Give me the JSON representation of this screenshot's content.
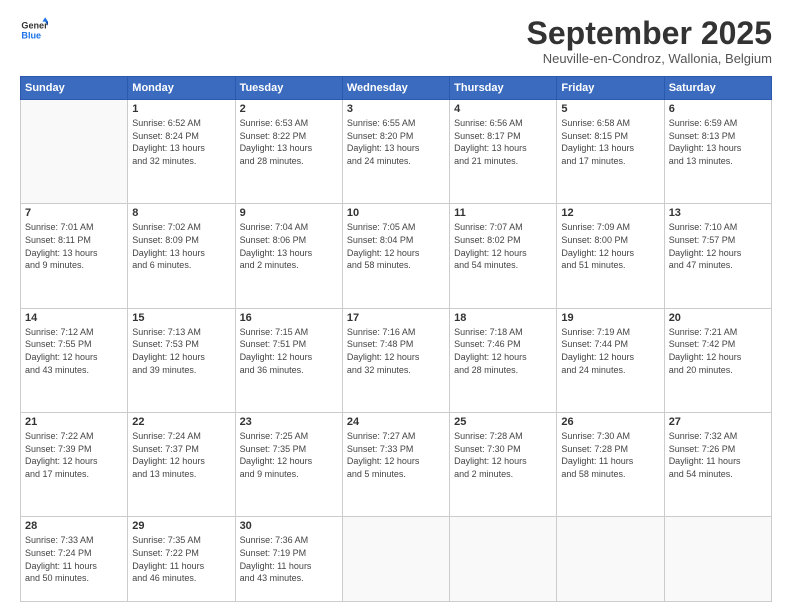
{
  "header": {
    "logo_line1": "General",
    "logo_line2": "Blue",
    "month_title": "September 2025",
    "location": "Neuville-en-Condroz, Wallonia, Belgium"
  },
  "days_of_week": [
    "Sunday",
    "Monday",
    "Tuesday",
    "Wednesday",
    "Thursday",
    "Friday",
    "Saturday"
  ],
  "weeks": [
    [
      {
        "day": "",
        "info": ""
      },
      {
        "day": "1",
        "info": "Sunrise: 6:52 AM\nSunset: 8:24 PM\nDaylight: 13 hours\nand 32 minutes."
      },
      {
        "day": "2",
        "info": "Sunrise: 6:53 AM\nSunset: 8:22 PM\nDaylight: 13 hours\nand 28 minutes."
      },
      {
        "day": "3",
        "info": "Sunrise: 6:55 AM\nSunset: 8:20 PM\nDaylight: 13 hours\nand 24 minutes."
      },
      {
        "day": "4",
        "info": "Sunrise: 6:56 AM\nSunset: 8:17 PM\nDaylight: 13 hours\nand 21 minutes."
      },
      {
        "day": "5",
        "info": "Sunrise: 6:58 AM\nSunset: 8:15 PM\nDaylight: 13 hours\nand 17 minutes."
      },
      {
        "day": "6",
        "info": "Sunrise: 6:59 AM\nSunset: 8:13 PM\nDaylight: 13 hours\nand 13 minutes."
      }
    ],
    [
      {
        "day": "7",
        "info": "Sunrise: 7:01 AM\nSunset: 8:11 PM\nDaylight: 13 hours\nand 9 minutes."
      },
      {
        "day": "8",
        "info": "Sunrise: 7:02 AM\nSunset: 8:09 PM\nDaylight: 13 hours\nand 6 minutes."
      },
      {
        "day": "9",
        "info": "Sunrise: 7:04 AM\nSunset: 8:06 PM\nDaylight: 13 hours\nand 2 minutes."
      },
      {
        "day": "10",
        "info": "Sunrise: 7:05 AM\nSunset: 8:04 PM\nDaylight: 12 hours\nand 58 minutes."
      },
      {
        "day": "11",
        "info": "Sunrise: 7:07 AM\nSunset: 8:02 PM\nDaylight: 12 hours\nand 54 minutes."
      },
      {
        "day": "12",
        "info": "Sunrise: 7:09 AM\nSunset: 8:00 PM\nDaylight: 12 hours\nand 51 minutes."
      },
      {
        "day": "13",
        "info": "Sunrise: 7:10 AM\nSunset: 7:57 PM\nDaylight: 12 hours\nand 47 minutes."
      }
    ],
    [
      {
        "day": "14",
        "info": "Sunrise: 7:12 AM\nSunset: 7:55 PM\nDaylight: 12 hours\nand 43 minutes."
      },
      {
        "day": "15",
        "info": "Sunrise: 7:13 AM\nSunset: 7:53 PM\nDaylight: 12 hours\nand 39 minutes."
      },
      {
        "day": "16",
        "info": "Sunrise: 7:15 AM\nSunset: 7:51 PM\nDaylight: 12 hours\nand 36 minutes."
      },
      {
        "day": "17",
        "info": "Sunrise: 7:16 AM\nSunset: 7:48 PM\nDaylight: 12 hours\nand 32 minutes."
      },
      {
        "day": "18",
        "info": "Sunrise: 7:18 AM\nSunset: 7:46 PM\nDaylight: 12 hours\nand 28 minutes."
      },
      {
        "day": "19",
        "info": "Sunrise: 7:19 AM\nSunset: 7:44 PM\nDaylight: 12 hours\nand 24 minutes."
      },
      {
        "day": "20",
        "info": "Sunrise: 7:21 AM\nSunset: 7:42 PM\nDaylight: 12 hours\nand 20 minutes."
      }
    ],
    [
      {
        "day": "21",
        "info": "Sunrise: 7:22 AM\nSunset: 7:39 PM\nDaylight: 12 hours\nand 17 minutes."
      },
      {
        "day": "22",
        "info": "Sunrise: 7:24 AM\nSunset: 7:37 PM\nDaylight: 12 hours\nand 13 minutes."
      },
      {
        "day": "23",
        "info": "Sunrise: 7:25 AM\nSunset: 7:35 PM\nDaylight: 12 hours\nand 9 minutes."
      },
      {
        "day": "24",
        "info": "Sunrise: 7:27 AM\nSunset: 7:33 PM\nDaylight: 12 hours\nand 5 minutes."
      },
      {
        "day": "25",
        "info": "Sunrise: 7:28 AM\nSunset: 7:30 PM\nDaylight: 12 hours\nand 2 minutes."
      },
      {
        "day": "26",
        "info": "Sunrise: 7:30 AM\nSunset: 7:28 PM\nDaylight: 11 hours\nand 58 minutes."
      },
      {
        "day": "27",
        "info": "Sunrise: 7:32 AM\nSunset: 7:26 PM\nDaylight: 11 hours\nand 54 minutes."
      }
    ],
    [
      {
        "day": "28",
        "info": "Sunrise: 7:33 AM\nSunset: 7:24 PM\nDaylight: 11 hours\nand 50 minutes."
      },
      {
        "day": "29",
        "info": "Sunrise: 7:35 AM\nSunset: 7:22 PM\nDaylight: 11 hours\nand 46 minutes."
      },
      {
        "day": "30",
        "info": "Sunrise: 7:36 AM\nSunset: 7:19 PM\nDaylight: 11 hours\nand 43 minutes."
      },
      {
        "day": "",
        "info": ""
      },
      {
        "day": "",
        "info": ""
      },
      {
        "day": "",
        "info": ""
      },
      {
        "day": "",
        "info": ""
      }
    ]
  ]
}
